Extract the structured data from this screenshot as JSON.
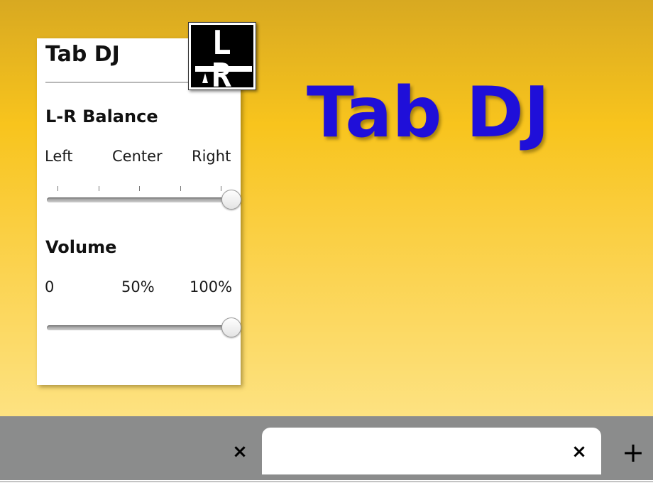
{
  "page": {
    "hero_title": "Tab DJ",
    "background_top": "#d8a921",
    "background_bottom": "#fde281",
    "hero_color": "#1f0fd9"
  },
  "popup": {
    "title": "Tab DJ",
    "logo": {
      "icon": "lr-balance-logo-icon",
      "text": "L R"
    },
    "balance": {
      "label": "L-R Balance",
      "scale_labels": [
        "Left",
        "Center",
        "Right"
      ],
      "value": 1.0
    },
    "volume": {
      "label": "Volume",
      "scale_labels": [
        "0",
        "50%",
        "100%"
      ],
      "value": 1.0
    }
  },
  "tabbar": {
    "tabs": [
      {
        "close_icon": "close-icon",
        "close_label": "×",
        "active": false
      },
      {
        "close_icon": "close-icon",
        "close_label": "×",
        "active": true
      }
    ],
    "new_tab_icon": "plus-icon",
    "new_tab_label": "+",
    "background": "#8b8c8c"
  }
}
